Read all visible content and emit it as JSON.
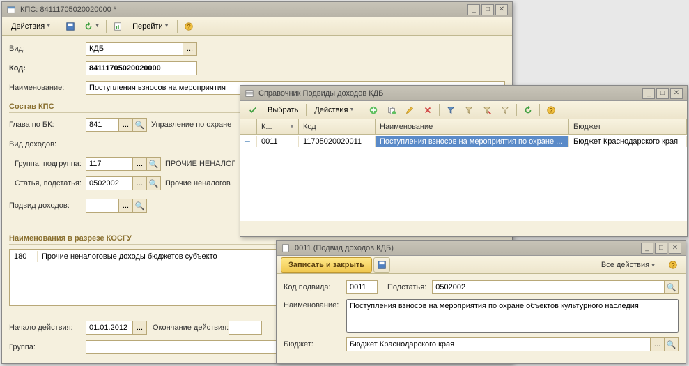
{
  "win1": {
    "title": "КПС: 84111705020020000 *",
    "toolbar": {
      "actions": "Действия",
      "goto": "Перейти"
    },
    "fields": {
      "vid_label": "Вид:",
      "vid_value": "КДБ",
      "kod_label": "Код:",
      "kod_value": "84111705020020000",
      "naim_label": "Наименование:",
      "naim_value": "Поступления взносов на мероприятия",
      "glava_label": "Глава по БК:",
      "glava_value": "841",
      "glava_desc": "Управление по охране",
      "viddoh_label": "Вид доходов:",
      "gruppa_label": "Группа, подгруппа:",
      "gruppa_value": "117",
      "gruppa_desc": "ПРОЧИЕ НЕНАЛОГ",
      "statya_label": "Статья, подстатья:",
      "statya_value": "0502002",
      "statya_desc": "Прочие неналогов",
      "podvid_label": "Подвид доходов:",
      "podvid_value": "",
      "nachalo_label": "Начало действия:",
      "nachalo_value": "01.01.2012",
      "okonch_label": "Окончание действия:",
      "okonch_value": "",
      "gruppa2_label": "Группа:",
      "gruppa2_value": ""
    },
    "sections": {
      "sostav": "Состав КПС",
      "kosgu": "Наименования в разрезе КОСГУ"
    },
    "kosgu_table": {
      "col1": "180",
      "col2": "Прочие неналоговые доходы бюджетов субъекто"
    }
  },
  "win2": {
    "title": "Справочник Подвиды доходов КДБ",
    "toolbar": {
      "select": "Выбрать",
      "actions": "Действия"
    },
    "headers": {
      "k": "К...",
      "kod": "Код",
      "naim": "Наименование",
      "budget": "Бюджет"
    },
    "row": {
      "k": "0011",
      "kod": "11705020020011",
      "naim": "Поступления взносов на мероприятия по охране ...",
      "budget": "Бюджет Краснодарского края"
    }
  },
  "win3": {
    "title": "0011 (Подвид доходов КДБ)",
    "save_close": "Записать и закрыть",
    "all_actions": "Все действия",
    "fields": {
      "kod_label": "Код подвида:",
      "kod_value": "0011",
      "podst_label": "Подстатья:",
      "podst_value": "0502002",
      "naim_label": "Наименование:",
      "naim_value": "Поступления взносов на мероприятия по охране объектов культурного наследия",
      "budget_label": "Бюджет:",
      "budget_value": "Бюджет Краснодарского края"
    }
  }
}
